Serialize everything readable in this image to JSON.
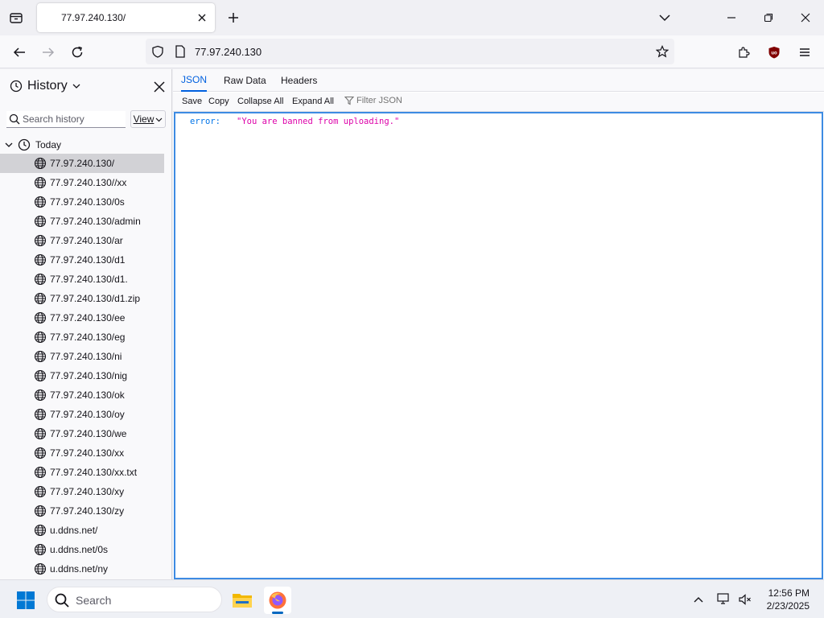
{
  "browser": {
    "tab": {
      "title": "77.97.240.130/"
    },
    "url": "77.97.240.130",
    "icons": {
      "tab_list": "tab-list-icon",
      "tab_close": "close-icon",
      "new_tab": "plus-icon",
      "tabs_overflow": "chevron-down-icon",
      "back": "back-arrow-icon",
      "forward": "forward-arrow-icon",
      "reload": "reload-icon",
      "shield": "tracking-protection-shield-icon",
      "page": "page-icon",
      "bookmark": "star-icon",
      "extensions": "puzzle-icon",
      "ublock": "ublock-origin-icon",
      "menu": "hamburger-menu-icon"
    }
  },
  "sidebar": {
    "title": "History",
    "search_placeholder": "Search history",
    "view_label": "View",
    "group_label": "Today",
    "items": [
      {
        "label": "77.97.240.130/",
        "selected": true
      },
      {
        "label": "77.97.240.130//xx"
      },
      {
        "label": "77.97.240.130/0s"
      },
      {
        "label": "77.97.240.130/admin"
      },
      {
        "label": "77.97.240.130/ar"
      },
      {
        "label": "77.97.240.130/d1"
      },
      {
        "label": "77.97.240.130/d1."
      },
      {
        "label": "77.97.240.130/d1.zip"
      },
      {
        "label": "77.97.240.130/ee"
      },
      {
        "label": "77.97.240.130/eg"
      },
      {
        "label": "77.97.240.130/ni"
      },
      {
        "label": "77.97.240.130/nig"
      },
      {
        "label": "77.97.240.130/ok"
      },
      {
        "label": "77.97.240.130/oy"
      },
      {
        "label": "77.97.240.130/we"
      },
      {
        "label": "77.97.240.130/xx"
      },
      {
        "label": "77.97.240.130/xx.txt"
      },
      {
        "label": "77.97.240.130/xy"
      },
      {
        "label": "77.97.240.130/zy"
      },
      {
        "label": "u.ddns.net/"
      },
      {
        "label": "u.ddns.net/0s"
      },
      {
        "label": "u.ddns.net/ny"
      }
    ]
  },
  "json_viewer": {
    "tabs": [
      "JSON",
      "Raw Data",
      "Headers"
    ],
    "active_tab": "JSON",
    "toolbar": {
      "save": "Save",
      "copy": "Copy",
      "collapse_all": "Collapse All",
      "expand_all": "Expand All",
      "filter_placeholder": "Filter JSON"
    },
    "rows": [
      {
        "key": "error:",
        "value": "\"You are banned from uploading.\""
      }
    ],
    "colors": {
      "key": "#0074e8",
      "string": "#dd00a9",
      "focus_border": "#3d8be3"
    }
  },
  "taskbar": {
    "search_label": "Search",
    "time": "12:56 PM",
    "date": "2/23/2025",
    "apps": [
      "file-explorer-icon",
      "firefox-icon"
    ]
  }
}
